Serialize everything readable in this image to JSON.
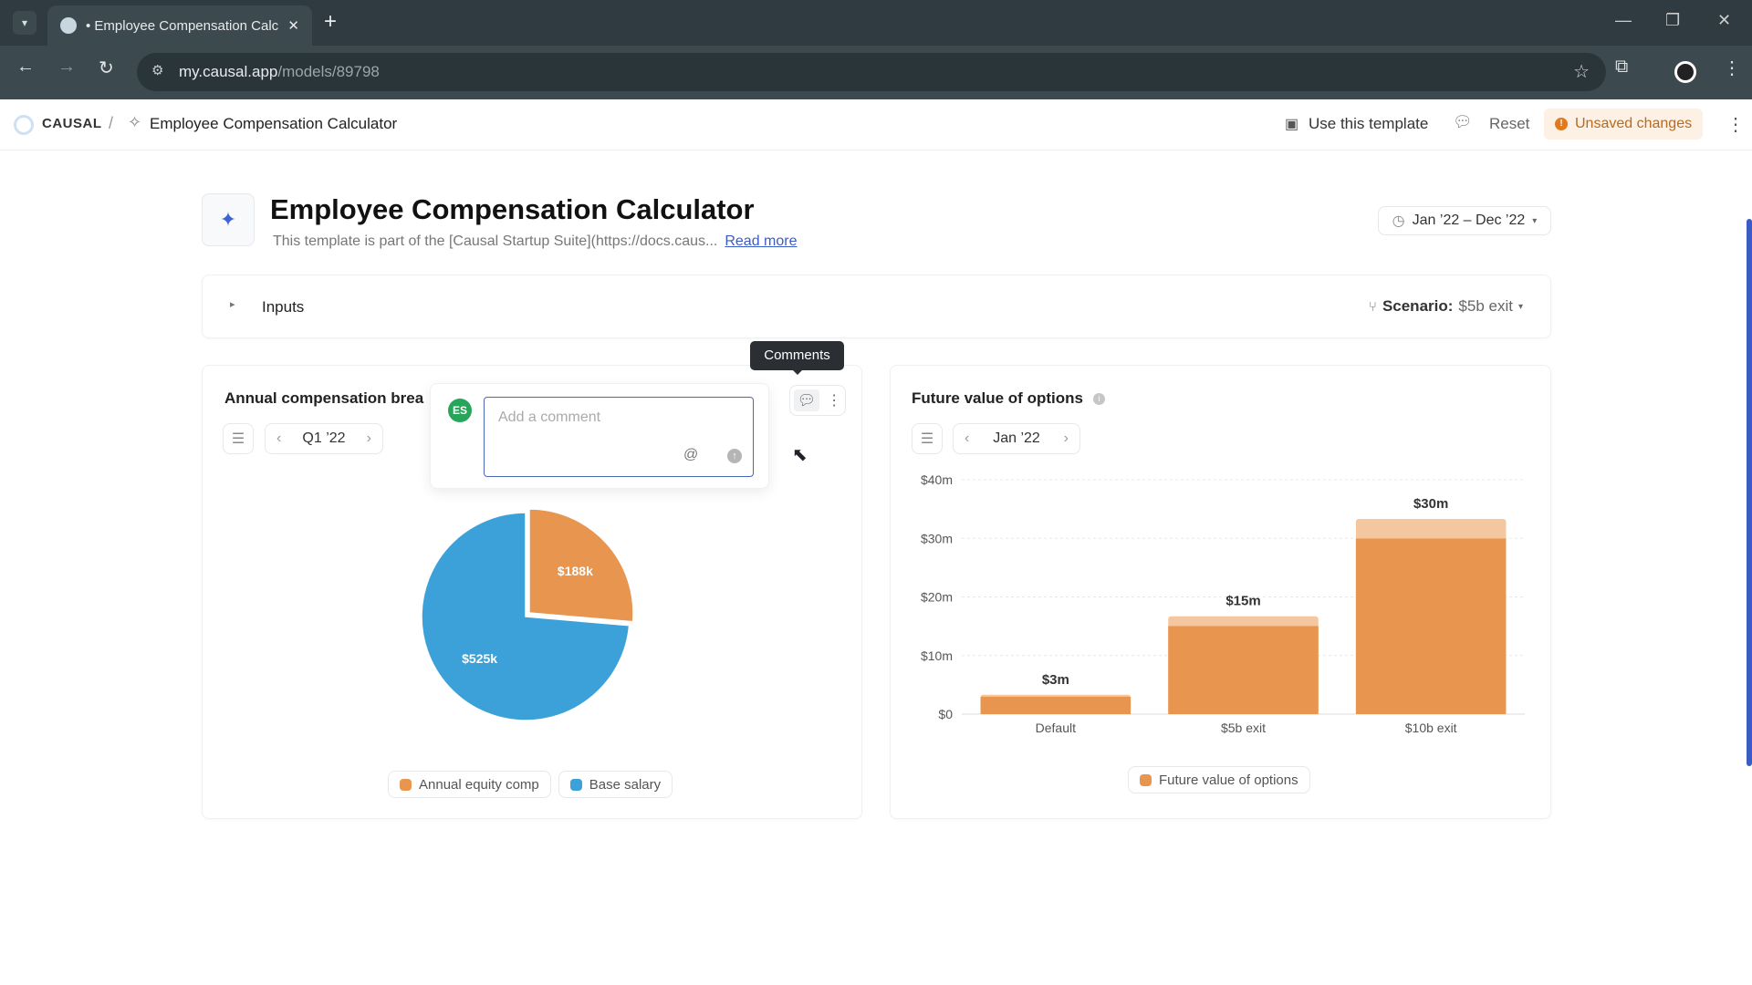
{
  "browser": {
    "tab_title": "• Employee Compensation Calc",
    "url_host": "my.causal.app",
    "url_path": "/models/89798"
  },
  "header": {
    "brand": "CAUSAL",
    "separator": "/",
    "breadcrumb": "Employee Compensation Calculator",
    "use_template": "Use this template",
    "reset": "Reset",
    "unsaved": "Unsaved changes"
  },
  "page": {
    "title": "Employee Compensation Calculator",
    "description": "This template is part of the [Causal Startup Suite](https://docs.caus...",
    "read_more": "Read more",
    "date_range": "Jan ’22 – Dec ’22"
  },
  "inputs": {
    "label": "Inputs",
    "scenario_label": "Scenario:",
    "scenario_value": "$5b exit"
  },
  "tooltip": "Comments",
  "comment": {
    "avatar": "ES",
    "placeholder": "Add a comment",
    "mention": "@"
  },
  "colors": {
    "orange": "#e8954f",
    "orange_light": "#f4c7a0",
    "blue": "#3ba1d8",
    "unsaved_bg": "#fdf0e4",
    "unsaved_text": "#b86a1f"
  },
  "chart_data": [
    {
      "type": "pie",
      "title": "Annual compensation brea",
      "period": "Q1 ’22",
      "slices": [
        {
          "name": "Annual equity comp",
          "value": 188,
          "label": "$188k",
          "color": "#e8954f"
        },
        {
          "name": "Base salary",
          "value": 525,
          "label": "$525k",
          "color": "#3ba1d8"
        }
      ]
    },
    {
      "type": "bar",
      "title": "Future value of options",
      "period": "Jan ’22",
      "categories": [
        "Default",
        "$5b exit",
        "$10b exit"
      ],
      "values": [
        3.3,
        16.7,
        33.3
      ],
      "labels": [
        "$3m",
        "$15m",
        "$30m"
      ],
      "series": [
        {
          "name": "Future value of options"
        }
      ],
      "yticks": [
        "$0",
        "$10m",
        "$20m",
        "$30m",
        "$40m"
      ],
      "ylim": [
        0,
        40
      ],
      "grid": true,
      "legend": "bottom"
    }
  ]
}
